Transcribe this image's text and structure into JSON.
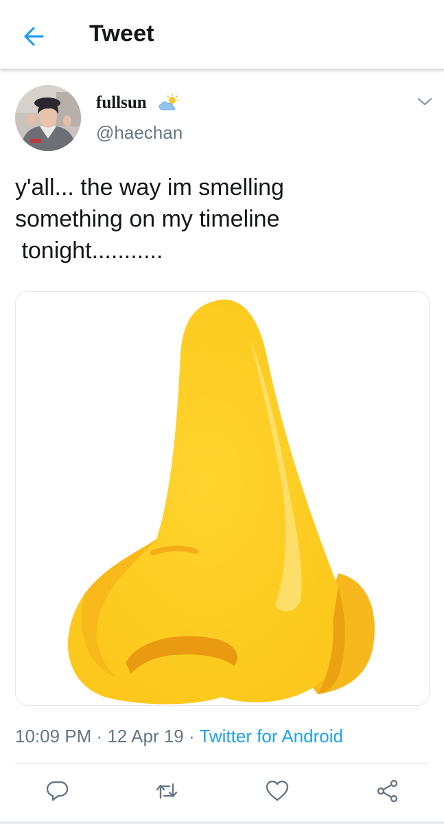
{
  "header": {
    "title": "Tweet",
    "back_icon": "arrow-left-icon",
    "accent_color": "#1da1f2"
  },
  "tweet": {
    "author": {
      "display_name": "fullsun",
      "name_emoji": "sun-behind-cloud-emoji",
      "handle": "@haechan"
    },
    "text": "y'all... the way im smelling\nsomething on my timeline\n tonight...........",
    "media": {
      "subject": "nose-emoji"
    },
    "timestamp": "10:09 PM",
    "date": "12 Apr 19",
    "separator": "·",
    "source": "Twitter for Android"
  },
  "actions": [
    {
      "name": "reply",
      "icon": "reply-icon"
    },
    {
      "name": "retweet",
      "icon": "retweet-icon"
    },
    {
      "name": "like",
      "icon": "heart-icon"
    },
    {
      "name": "share",
      "icon": "share-icon"
    }
  ]
}
